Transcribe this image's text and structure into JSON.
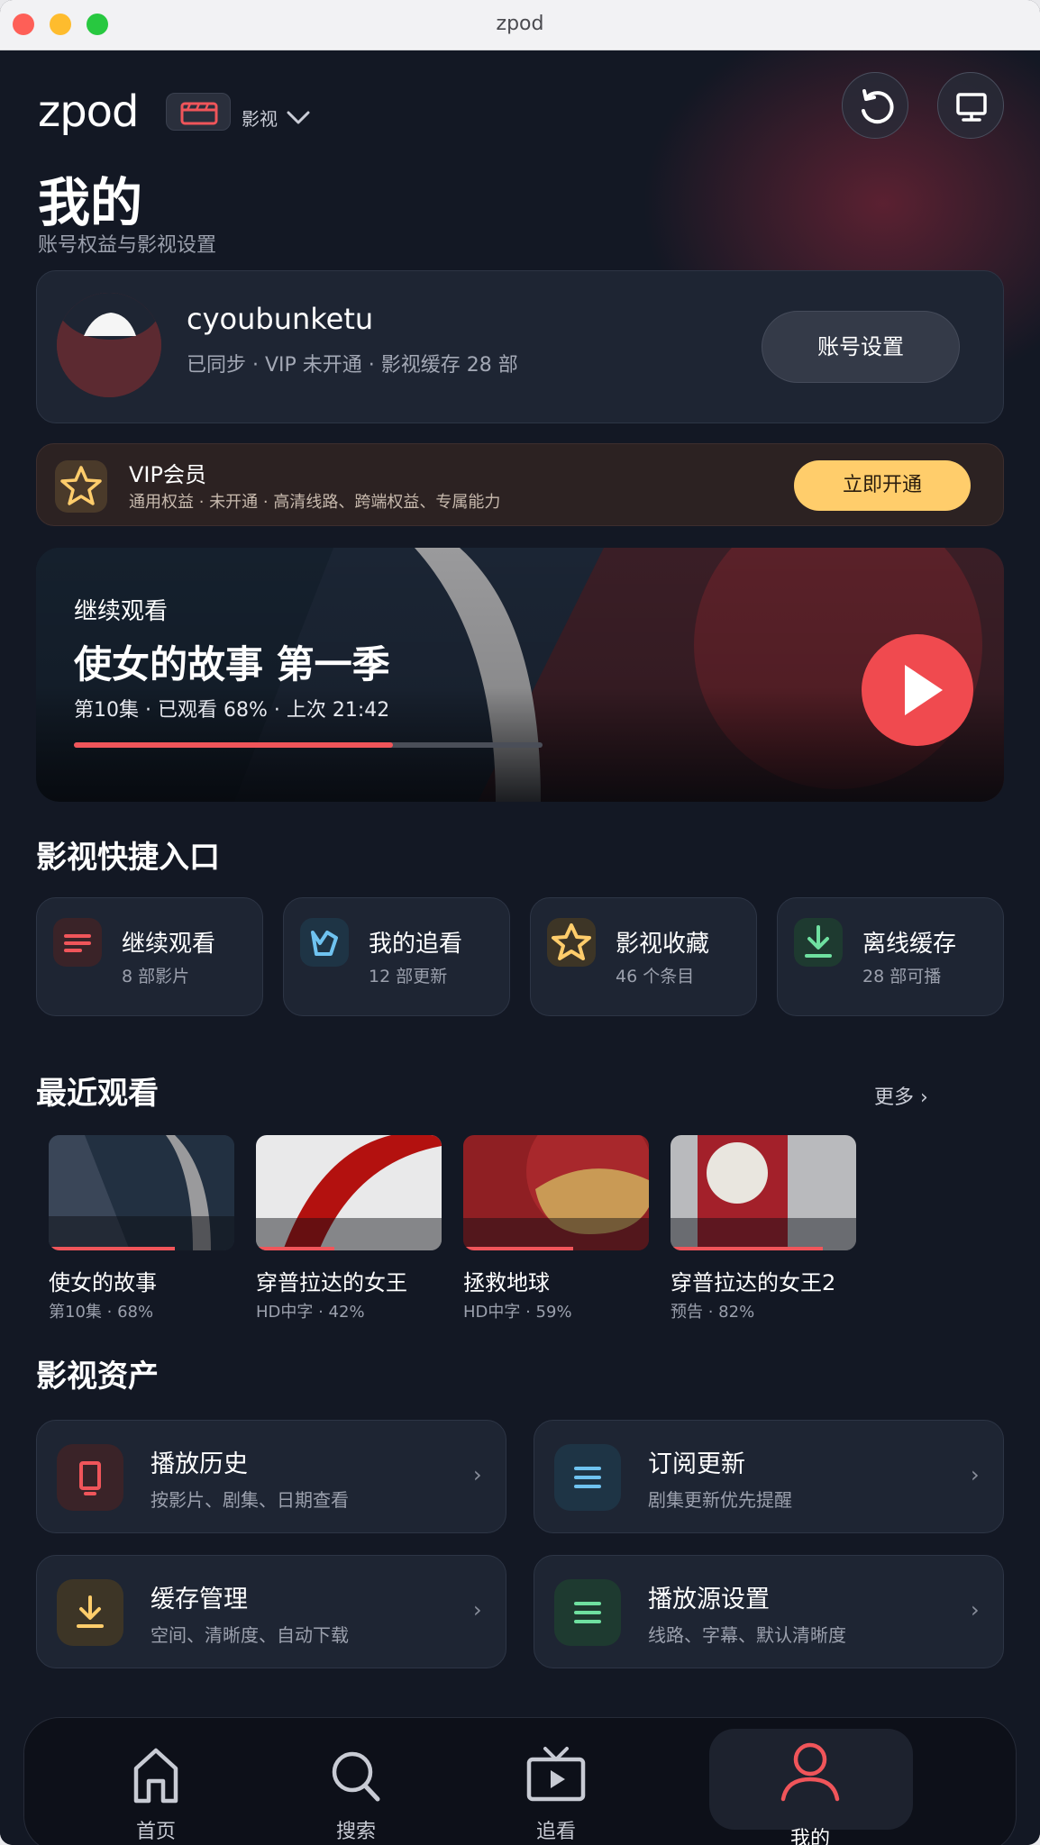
{
  "window": {
    "title": "zpod"
  },
  "header": {
    "brand": "zpod",
    "category_label": "影视"
  },
  "page": {
    "title": "我的",
    "subtitle": "账号权益与影视设置"
  },
  "profile": {
    "username": "cyoubunketu",
    "status_line": "已同步 · VIP 未开通 · 影视缓存 28 部",
    "settings_button": "账号设置"
  },
  "vip": {
    "title": "VIP会员",
    "description": "通用权益 · 未开通 · 高清线路、跨端权益、专属能力",
    "button": "立即开通"
  },
  "continue_watching": {
    "kicker": "继续观看",
    "title": "使女的故事 第一季",
    "meta": "第10集 · 已观看 68% · 上次 21:42",
    "progress": 0.68
  },
  "quick_entries": {
    "section_title": "影视快捷入口",
    "items": [
      {
        "name": "继续观看",
        "sub": "8 部影片",
        "icon": "continue-list-icon",
        "color": "#f0555a",
        "bg": "#3a2328"
      },
      {
        "name": "我的追看",
        "sub": "12 部更新",
        "icon": "bookmark-crown-icon",
        "color": "#6fc3f0",
        "bg": "#1e3445"
      },
      {
        "name": "影视收藏",
        "sub": "46 个条目",
        "icon": "star-icon",
        "color": "#ffcd6b",
        "bg": "#3d3526"
      },
      {
        "name": "离线缓存",
        "sub": "28 部可播",
        "icon": "download-icon",
        "color": "#6fe0a0",
        "bg": "#1e3a30"
      }
    ]
  },
  "recent": {
    "section_title": "最近观看",
    "more": "更多 ›",
    "items": [
      {
        "title": "使女的故事",
        "sub": "第10集 · 68%",
        "progress": 0.68
      },
      {
        "title": "穿普拉达的女王",
        "sub": "HD中字 · 42%",
        "progress": 0.42
      },
      {
        "title": "拯救地球",
        "sub": "HD中字 · 59%",
        "progress": 0.59
      },
      {
        "title": "穿普拉达的女王2",
        "sub": "预告 · 82%",
        "progress": 0.82
      }
    ]
  },
  "assets": {
    "section_title": "影视资产",
    "items": [
      {
        "name": "播放历史",
        "sub": "按影片、剧集、日期查看",
        "icon": "phone-history-icon",
        "color": "#f0555a",
        "bg": "#3a2328"
      },
      {
        "name": "订阅更新",
        "sub": "剧集更新优先提醒",
        "icon": "list-lines-icon",
        "color": "#6fc3f0",
        "bg": "#1e3445"
      },
      {
        "name": "缓存管理",
        "sub": "空间、清晰度、自动下载",
        "icon": "download-icon",
        "color": "#ffcd6b",
        "bg": "#3d3526"
      },
      {
        "name": "播放源设置",
        "sub": "线路、字幕、默认清晰度",
        "icon": "list-lines-icon",
        "color": "#6fe0a0",
        "bg": "#1e3a30"
      }
    ],
    "chevron": "›"
  },
  "nav": {
    "items": [
      {
        "label": "首页",
        "icon": "home-icon"
      },
      {
        "label": "搜索",
        "icon": "search-icon"
      },
      {
        "label": "追看",
        "icon": "tv-icon"
      },
      {
        "label": "我的",
        "icon": "user-icon"
      }
    ],
    "active_index": 3
  }
}
